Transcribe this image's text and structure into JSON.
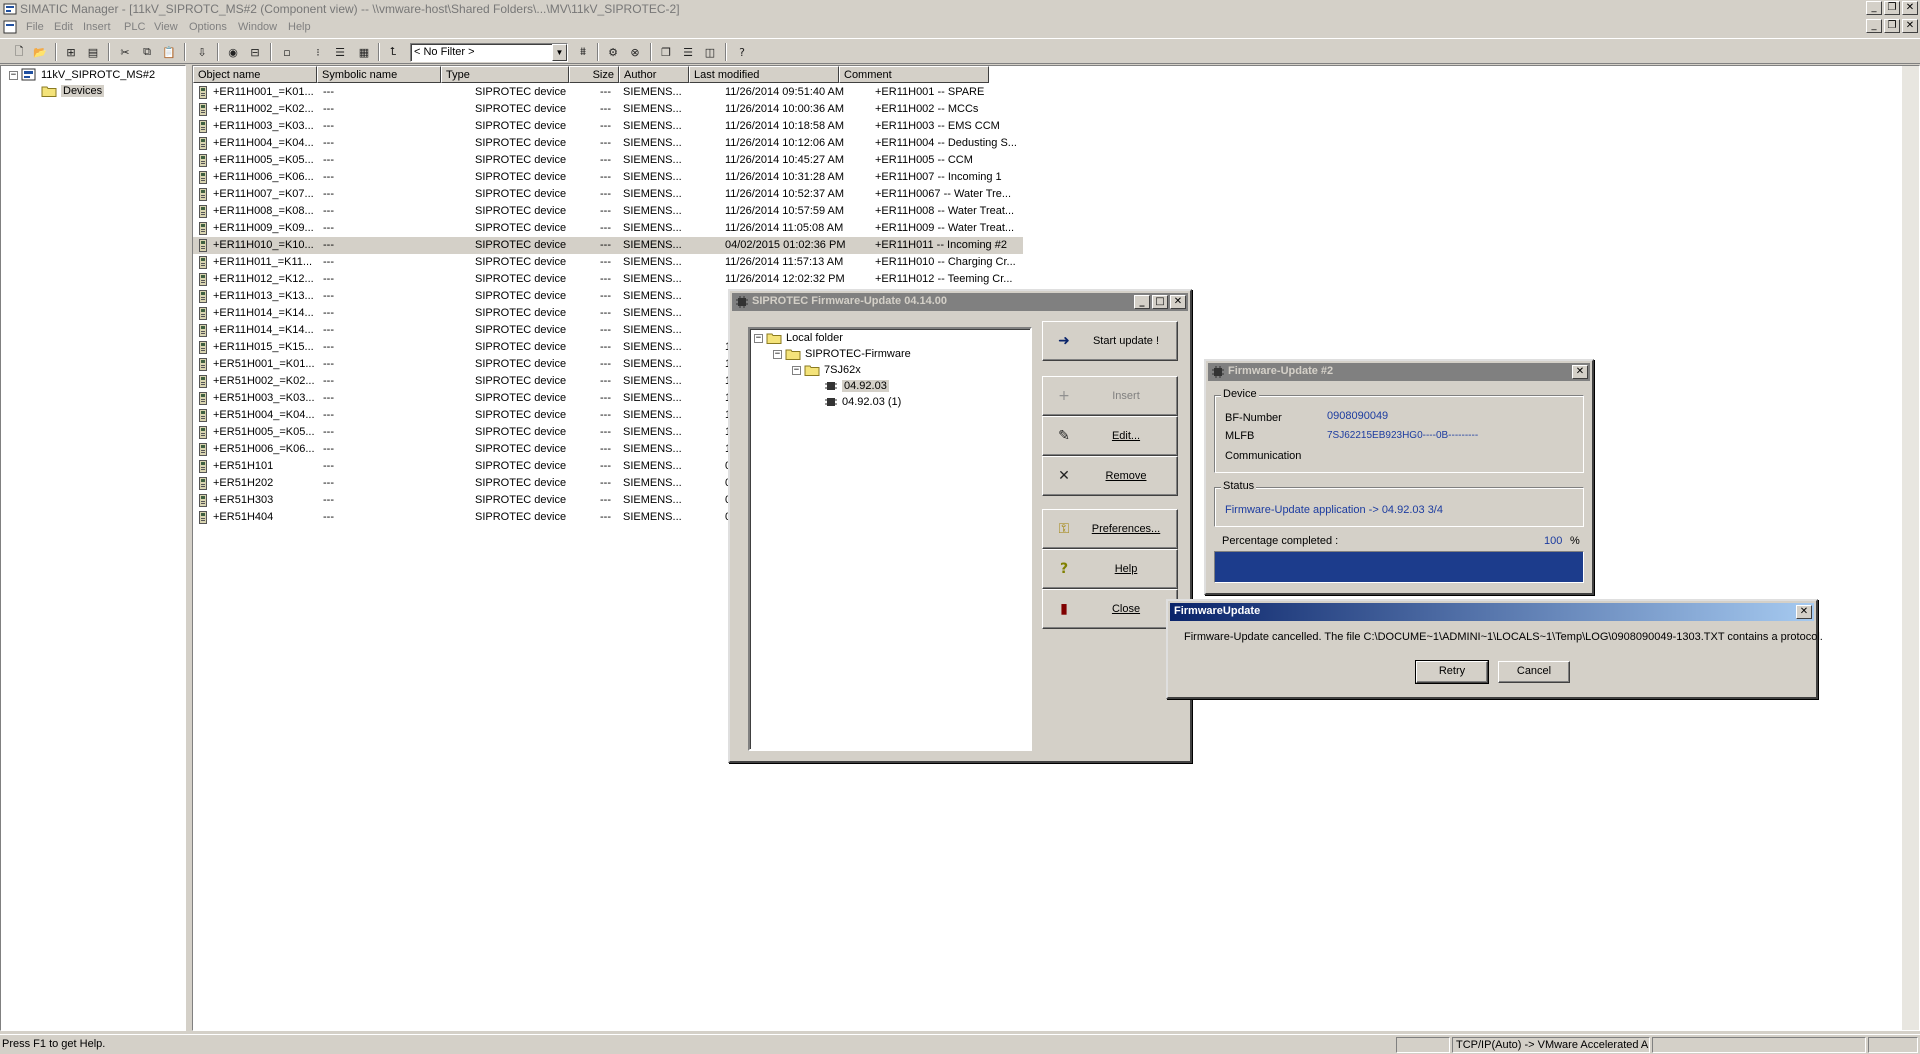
{
  "app": {
    "title": "SIMATIC Manager - [11kV_SIPROTC_MS#2 (Component view) -- \\\\vmware-host\\Shared Folders\\...\\MV\\11kV_SIPROTEC-2]"
  },
  "menu": [
    "File",
    "Edit",
    "Insert",
    "PLC",
    "View",
    "Options",
    "Window",
    "Help"
  ],
  "toolbar": {
    "filter_value": "< No Filter >"
  },
  "tree": {
    "root": "11kV_SIPROTC_MS#2",
    "child": "Devices"
  },
  "list": {
    "headers": [
      "Object name",
      "Symbolic name",
      "Type",
      "Size",
      "Author",
      "Last modified",
      "Comment"
    ],
    "rows": [
      {
        "name": "+ER11H001_=K01...",
        "sym": "---",
        "type": "SIPROTEC device",
        "size": "---",
        "author": "SIEMENS...",
        "modified": "11/26/2014 09:51:40 AM",
        "comment": "+ER11H001 -- SPARE"
      },
      {
        "name": "+ER11H002_=K02...",
        "sym": "---",
        "type": "SIPROTEC device",
        "size": "---",
        "author": "SIEMENS...",
        "modified": "11/26/2014 10:00:36 AM",
        "comment": "+ER11H002 -- MCCs"
      },
      {
        "name": "+ER11H003_=K03...",
        "sym": "---",
        "type": "SIPROTEC device",
        "size": "---",
        "author": "SIEMENS...",
        "modified": "11/26/2014 10:18:58 AM",
        "comment": "+ER11H003 -- EMS CCM"
      },
      {
        "name": "+ER11H004_=K04...",
        "sym": "---",
        "type": "SIPROTEC device",
        "size": "---",
        "author": "SIEMENS...",
        "modified": "11/26/2014 10:12:06 AM",
        "comment": "+ER11H004 -- Dedusting S..."
      },
      {
        "name": "+ER11H005_=K05...",
        "sym": "---",
        "type": "SIPROTEC device",
        "size": "---",
        "author": "SIEMENS...",
        "modified": "11/26/2014 10:45:27 AM",
        "comment": "+ER11H005 -- CCM"
      },
      {
        "name": "+ER11H006_=K06...",
        "sym": "---",
        "type": "SIPROTEC device",
        "size": "---",
        "author": "SIEMENS...",
        "modified": "11/26/2014 10:31:28 AM",
        "comment": "+ER11H007 -- Incoming 1"
      },
      {
        "name": "+ER11H007_=K07...",
        "sym": "---",
        "type": "SIPROTEC device",
        "size": "---",
        "author": "SIEMENS...",
        "modified": "11/26/2014 10:52:37 AM",
        "comment": "+ER11H0067 -- Water Tre..."
      },
      {
        "name": "+ER11H008_=K08...",
        "sym": "---",
        "type": "SIPROTEC device",
        "size": "---",
        "author": "SIEMENS...",
        "modified": "11/26/2014 10:57:59 AM",
        "comment": "+ER11H008 -- Water Treat..."
      },
      {
        "name": "+ER11H009_=K09...",
        "sym": "---",
        "type": "SIPROTEC device",
        "size": "---",
        "author": "SIEMENS...",
        "modified": "11/26/2014 11:05:08 AM",
        "comment": "+ER11H009 -- Water Treat..."
      },
      {
        "name": "+ER11H010_=K10...",
        "sym": "---",
        "type": "SIPROTEC device",
        "size": "---",
        "author": "SIEMENS...",
        "modified": "04/02/2015 01:02:36 PM",
        "comment": "+ER11H011 -- Incoming #2",
        "selected": true
      },
      {
        "name": "+ER11H011_=K11...",
        "sym": "---",
        "type": "SIPROTEC device",
        "size": "---",
        "author": "SIEMENS...",
        "modified": "11/26/2014 11:57:13 AM",
        "comment": "+ER11H010 -- Charging Cr..."
      },
      {
        "name": "+ER11H012_=K12...",
        "sym": "---",
        "type": "SIPROTEC device",
        "size": "---",
        "author": "SIEMENS...",
        "modified": "11/26/2014 12:02:32 PM",
        "comment": "+ER11H012 -- Teeming Cr..."
      },
      {
        "name": "+ER11H013_=K13...",
        "sym": "---",
        "type": "SIPROTEC device",
        "size": "---",
        "author": "SIEMENS...",
        "modified": "",
        "comment": ""
      },
      {
        "name": "+ER11H014_=K14...",
        "sym": "---",
        "type": "SIPROTEC device",
        "size": "---",
        "author": "SIEMENS...",
        "modified": "",
        "comment": ""
      },
      {
        "name": "+ER11H014_=K14...",
        "sym": "---",
        "type": "SIPROTEC device",
        "size": "---",
        "author": "SIEMENS...",
        "modified": "",
        "comment": ""
      },
      {
        "name": "+ER11H015_=K15...",
        "sym": "---",
        "type": "SIPROTEC device",
        "size": "---",
        "author": "SIEMENS...",
        "modified": "1",
        "comment": ""
      },
      {
        "name": "+ER51H001_=K01...",
        "sym": "---",
        "type": "SIPROTEC device",
        "size": "---",
        "author": "SIEMENS...",
        "modified": "1",
        "comment": ""
      },
      {
        "name": "+ER51H002_=K02...",
        "sym": "---",
        "type": "SIPROTEC device",
        "size": "---",
        "author": "SIEMENS...",
        "modified": "1",
        "comment": ""
      },
      {
        "name": "+ER51H003_=K03...",
        "sym": "---",
        "type": "SIPROTEC device",
        "size": "---",
        "author": "SIEMENS...",
        "modified": "1",
        "comment": ""
      },
      {
        "name": "+ER51H004_=K04...",
        "sym": "---",
        "type": "SIPROTEC device",
        "size": "---",
        "author": "SIEMENS...",
        "modified": "1",
        "comment": ""
      },
      {
        "name": "+ER51H005_=K05...",
        "sym": "---",
        "type": "SIPROTEC device",
        "size": "---",
        "author": "SIEMENS...",
        "modified": "1",
        "comment": ""
      },
      {
        "name": "+ER51H006_=K06...",
        "sym": "---",
        "type": "SIPROTEC device",
        "size": "---",
        "author": "SIEMENS...",
        "modified": "1",
        "comment": ""
      },
      {
        "name": "+ER51H101",
        "sym": "---",
        "type": "SIPROTEC device",
        "size": "---",
        "author": "SIEMENS...",
        "modified": "0",
        "comment": ""
      },
      {
        "name": "+ER51H202",
        "sym": "---",
        "type": "SIPROTEC device",
        "size": "---",
        "author": "SIEMENS...",
        "modified": "0",
        "comment": ""
      },
      {
        "name": "+ER51H303",
        "sym": "---",
        "type": "SIPROTEC device",
        "size": "---",
        "author": "SIEMENS...",
        "modified": "0",
        "comment": ""
      },
      {
        "name": "+ER51H404",
        "sym": "---",
        "type": "SIPROTEC device",
        "size": "---",
        "author": "SIEMENS...",
        "modified": "0",
        "comment": ""
      }
    ]
  },
  "fw_dialog": {
    "title": "SIPROTEC Firmware-Update 04.14.00",
    "tree": {
      "local_folder": "Local folder",
      "firmware": "SIPROTEC-Firmware",
      "family": "7SJ62x",
      "version1": "04.92.03",
      "version2": "04.92.03 (1)"
    },
    "buttons": {
      "start": "Start update !",
      "insert": "Insert",
      "edit": "Edit...",
      "remove": "Remove",
      "preferences": "Preferences...",
      "help": "Help",
      "close": "Close"
    }
  },
  "progress_dialog": {
    "title": "Firmware-Update #2",
    "device_group": "Device",
    "bf_label": "BF-Number",
    "bf_value": "0908090049",
    "mlfb_label": "MLFB",
    "mlfb_value": "7SJ62215EB923HG0----0B---------",
    "comm_label": "Communication",
    "status_group": "Status",
    "status_value": "Firmware-Update  application  ->  04.92.03 3/4",
    "pct_label": "Percentage completed :",
    "pct_value": "100",
    "pct_unit": "%",
    "progress_fraction": 1.0
  },
  "msg_dialog": {
    "title": "FirmwareUpdate",
    "message": "Firmware-Update cancelled. The file C:\\DOCUME~1\\ADMINI~1\\LOCALS~1\\Temp\\LOG\\0908090049-1303.TXT contains a protocol.",
    "retry": "Retry",
    "cancel": "Cancel"
  },
  "statusbar": {
    "help": "Press F1 to get Help.",
    "interface": "TCP/IP(Auto) -> VMware Accelerated AI"
  },
  "colors": {
    "progress": "#0a246a",
    "active_title": "#0a246a",
    "value_text": "#1c3ca0"
  }
}
